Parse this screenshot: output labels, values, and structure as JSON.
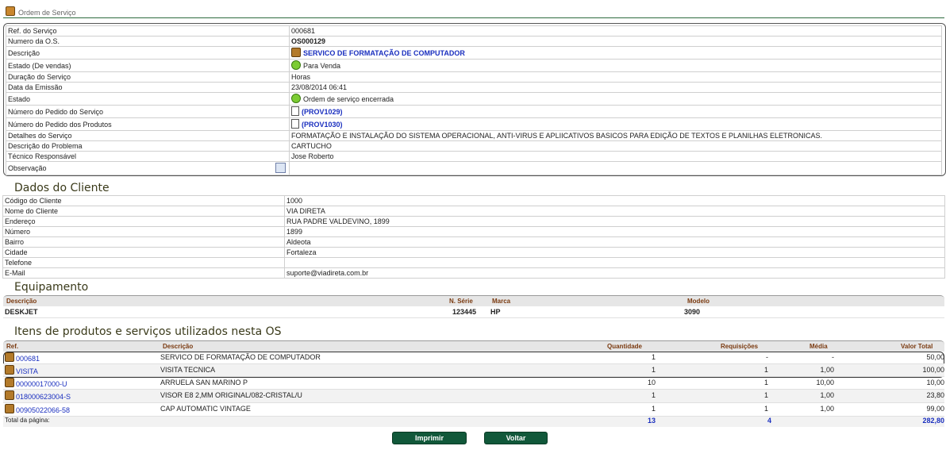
{
  "page_title": "Ordem de Serviço",
  "os": {
    "rows": [
      {
        "label": "Ref. do Serviço",
        "value": "000681"
      },
      {
        "label": "Numero da O.S.",
        "value": "OS000129"
      },
      {
        "label": "Descrição",
        "value": "SERVICO DE FORMATAÇÃO DE COMPUTADOR"
      },
      {
        "label": "Estado (De vendas)",
        "value": "Para Venda"
      },
      {
        "label": "Duração do Serviço",
        "value": "Horas"
      },
      {
        "label": "Data da Emissão",
        "value": "23/08/2014 06:41"
      },
      {
        "label": "Estado",
        "value": "Ordem de serviço encerrada"
      },
      {
        "label": "Número do Pedido do Serviço",
        "value": "(PROV1029)"
      },
      {
        "label": "Número do Pedido dos Produtos",
        "value": "(PROV1030)"
      },
      {
        "label": "Detalhes do Serviço",
        "value": "FORMATAÇÃO E INSTALAÇÃO DO SISTEMA OPERACIONAL, ANTI-VIRUS E APLIICATIVOS BASICOS PARA EDIÇÃO DE TEXTOS E PLANILHAS ELETRONICAS."
      },
      {
        "label": "Descrição do Problema",
        "value": "CARTUCHO"
      },
      {
        "label": "Técnico Responsável",
        "value": "Jose Roberto"
      },
      {
        "label": "Observação",
        "value": ""
      }
    ]
  },
  "cliente": {
    "title": "Dados do Cliente",
    "rows": [
      {
        "label": "Código do Cliente",
        "value": "1000"
      },
      {
        "label": "Nome do Cliente",
        "value": "VIA DIRETA"
      },
      {
        "label": "Endereço",
        "value": "RUA PADRE VALDEVINO, 1899"
      },
      {
        "label": "Número",
        "value": "1899"
      },
      {
        "label": "Bairro",
        "value": "Aldeota"
      },
      {
        "label": "Cidade",
        "value": "Fortaleza"
      },
      {
        "label": "Telefone",
        "value": ""
      },
      {
        "label": "E-Mail",
        "value": "suporte@viadireta.com.br"
      }
    ]
  },
  "equipamento": {
    "title": "Equipamento",
    "headers": {
      "descricao": "Descrição",
      "serie": "N. Série",
      "marca": "Marca",
      "modelo": "Modelo"
    },
    "row": {
      "descricao": "DESKJET",
      "serie": "123445",
      "marca": "HP",
      "modelo": "3090"
    }
  },
  "itens": {
    "title": "Itens de produtos e serviços utilizados nesta OS",
    "headers": {
      "ref": "Ref.",
      "descricao": "Descrição",
      "quantidade": "Quantidade",
      "requisicoes": "Requisições",
      "media": "Média",
      "valor": "Valor Total"
    },
    "rows": [
      {
        "ref": "000681",
        "descricao": "SERVICO DE FORMATAÇÃO DE COMPUTADOR",
        "quantidade": "1",
        "requisicoes": "-",
        "media": "-",
        "valor": "50,00"
      },
      {
        "ref": "VISITA",
        "descricao": "VISITA TECNICA",
        "quantidade": "1",
        "requisicoes": "1",
        "media": "1,00",
        "valor": "100,00"
      },
      {
        "ref": "00000017000-U",
        "descricao": "ARRUELA SAN MARINO P",
        "quantidade": "10",
        "requisicoes": "1",
        "media": "10,00",
        "valor": "10,00"
      },
      {
        "ref": "018000623004-S",
        "descricao": "VISOR E8 2,MM ORIGINAL/082-CRISTAL/U",
        "quantidade": "1",
        "requisicoes": "1",
        "media": "1,00",
        "valor": "23,80"
      },
      {
        "ref": "00905022066-58",
        "descricao": "CAP AUTOMATIC VINTAGE",
        "quantidade": "1",
        "requisicoes": "1",
        "media": "1,00",
        "valor": "99,00"
      }
    ],
    "total": {
      "label": "Total da página:",
      "quantidade": "13",
      "requisicoes": "4",
      "valor": "282,80"
    }
  },
  "buttons": {
    "imprimir": "Imprimir",
    "voltar": "Voltar"
  }
}
